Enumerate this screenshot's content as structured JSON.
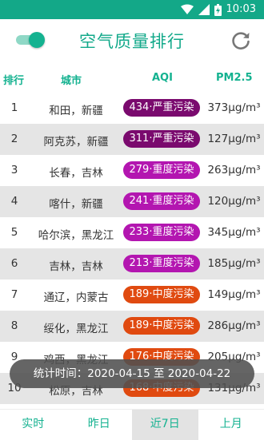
{
  "status_bar": {
    "time": "10:03",
    "icons": [
      "wifi-icon",
      "signal-icon",
      "battery-icon"
    ]
  },
  "app_bar": {
    "title": "空气质量排行",
    "toggle_on": true
  },
  "header": {
    "rank": "排行",
    "city": "城市",
    "aqi": "AQI",
    "pm": "PM2.5"
  },
  "colors": {
    "accent": "#14b290",
    "severe": "#7a0a6e",
    "heavy": "#b316b0",
    "moderate": "#e04a10"
  },
  "rows": [
    {
      "rank": "1",
      "city": "和田，新疆",
      "aqi": "434·严重污染",
      "level": "severe",
      "pm": "373μg/m³"
    },
    {
      "rank": "2",
      "city": "阿克苏，新疆",
      "aqi": "311·严重污染",
      "level": "severe",
      "pm": "127μg/m³"
    },
    {
      "rank": "3",
      "city": "长春，吉林",
      "aqi": "279·重度污染",
      "level": "heavy",
      "pm": "263μg/m³"
    },
    {
      "rank": "4",
      "city": "喀什，新疆",
      "aqi": "241·重度污染",
      "level": "heavy",
      "pm": "120μg/m³"
    },
    {
      "rank": "5",
      "city": "哈尔滨，黑龙江",
      "aqi": "233·重度污染",
      "level": "heavy",
      "pm": "345μg/m³"
    },
    {
      "rank": "6",
      "city": "吉林，吉林",
      "aqi": "213·重度污染",
      "level": "heavy",
      "pm": "185μg/m³"
    },
    {
      "rank": "7",
      "city": "通辽，内蒙古",
      "aqi": "189·中度污染",
      "level": "moderate",
      "pm": "149μg/m³"
    },
    {
      "rank": "8",
      "city": "绥化，黑龙江",
      "aqi": "189·中度污染",
      "level": "moderate",
      "pm": "286μg/m³"
    },
    {
      "rank": "9",
      "city": "鸡西，黑龙江",
      "aqi": "176·中度污染",
      "level": "moderate",
      "pm": "205μg/m³"
    },
    {
      "rank": "10",
      "city": "松原，吉林",
      "aqi": "168·中度污染",
      "level": "moderate",
      "pm": "131μg/m³"
    }
  ],
  "toast": {
    "text": "统计时间：2020-04-15 至 2020-04-22"
  },
  "tabs": [
    {
      "label": "实时",
      "active": false
    },
    {
      "label": "昨日",
      "active": false
    },
    {
      "label": "近7日",
      "active": true
    },
    {
      "label": "上月",
      "active": false
    }
  ]
}
